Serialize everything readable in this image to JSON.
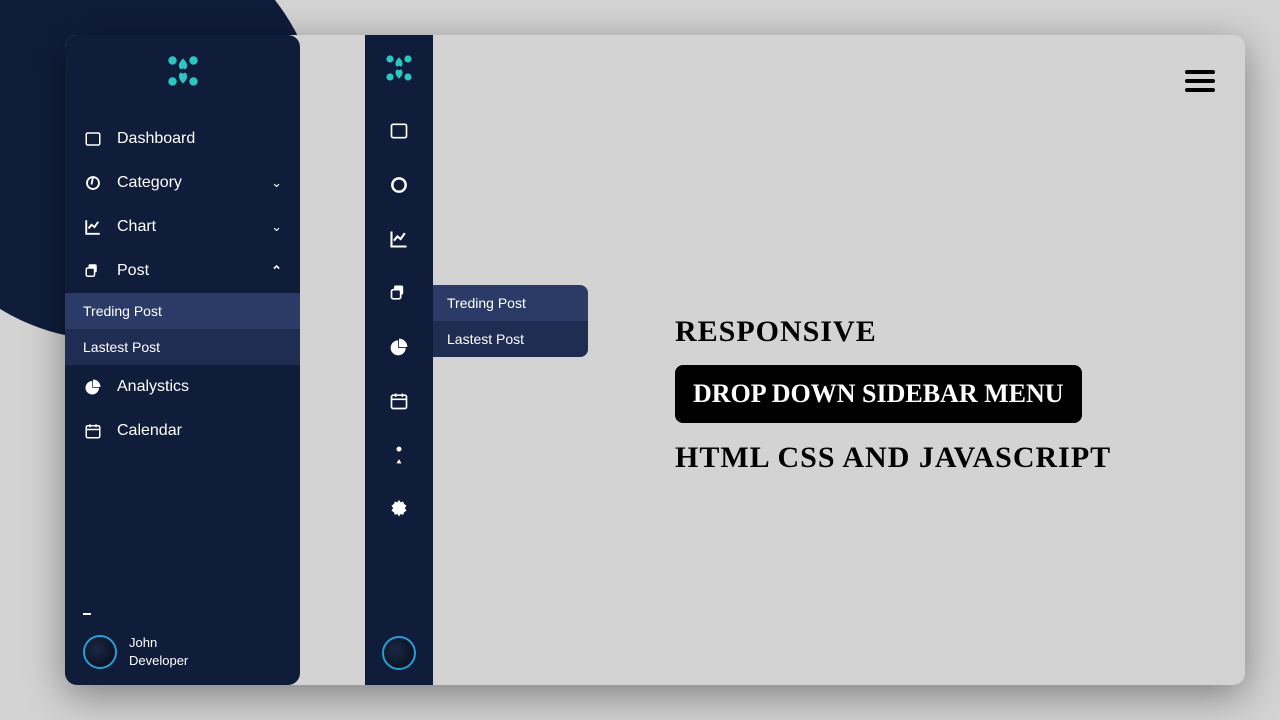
{
  "sidebar": {
    "items": [
      {
        "label": "Dashboard",
        "chevron": ""
      },
      {
        "label": "Category",
        "chevron": "⌄"
      },
      {
        "label": "Chart",
        "chevron": "⌄"
      },
      {
        "label": "Post",
        "chevron": "⌃"
      },
      {
        "label": "Analystics",
        "chevron": ""
      },
      {
        "label": "Calendar",
        "chevron": ""
      }
    ],
    "sub": [
      {
        "label": "Treding Post"
      },
      {
        "label": "Lastest Post"
      }
    ]
  },
  "flyout": {
    "items": [
      {
        "label": "Treding Post"
      },
      {
        "label": "Lastest Post"
      }
    ]
  },
  "user": {
    "name": "John",
    "role": "Developer"
  },
  "hero": {
    "line1": "RESPONSIVE",
    "line2": "DROP DOWN SIDEBAR MENU",
    "line3": "HTML CSS AND JAVASCRIPT"
  }
}
